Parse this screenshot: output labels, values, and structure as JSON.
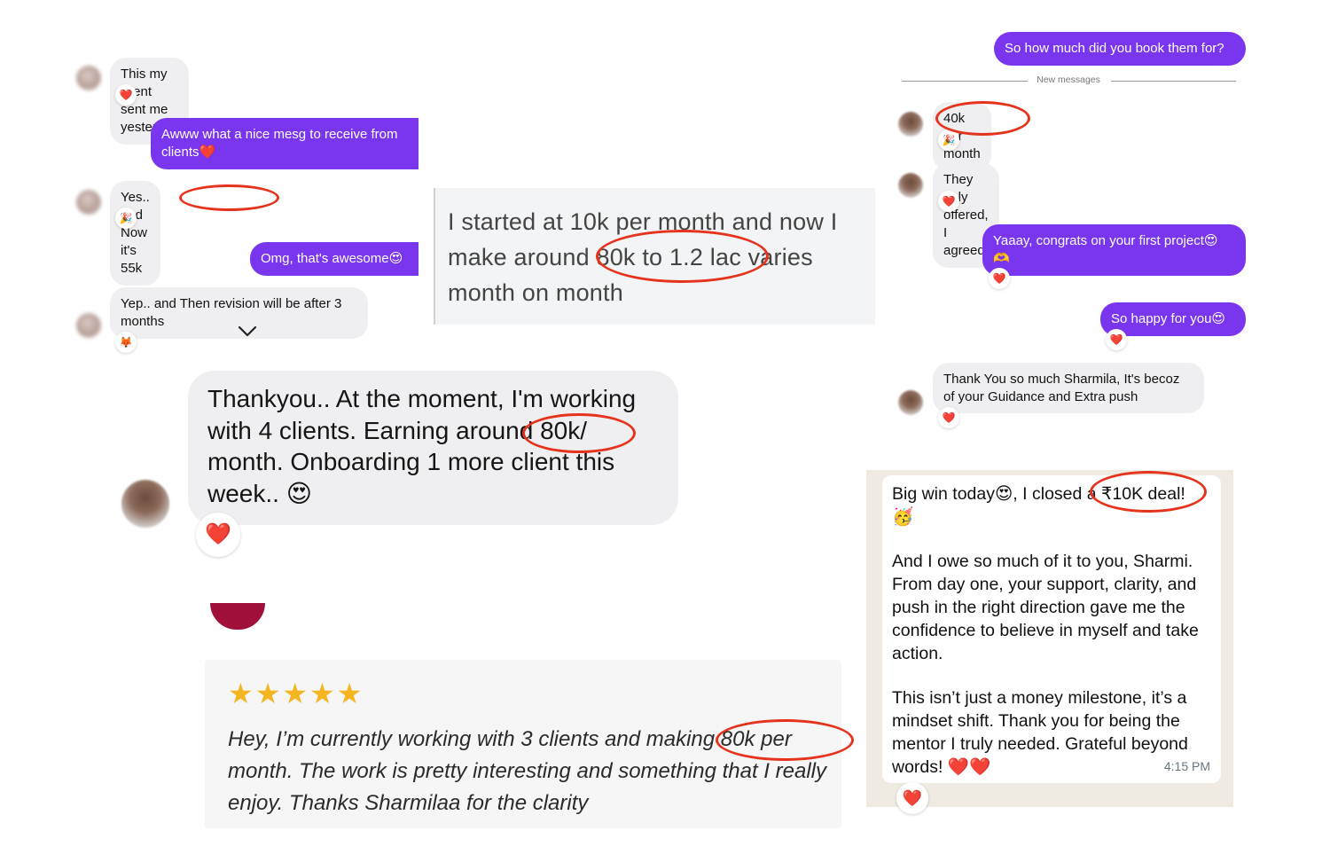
{
  "left_chat": {
    "msg1": "This my client sent me yesterday",
    "msg2": "Awww what a nice mesg to receive from clients❤️",
    "msg3": "Yes.. and Now it's 55k",
    "msg4": "Omg, that's awesome😍",
    "msg5": "Yep.. and Then revision will be after 3 months"
  },
  "center_card": {
    "text": "I started at 10k per month and now I make around 80k to 1.2 lac varies month on month"
  },
  "big_bubble": {
    "text": "Thankyou.. At the moment, I'm working with 4 clients. Earning around 80k/ month. Onboarding 1 more  client this week.. 😍"
  },
  "review": {
    "stars": "★★★★★",
    "text": "Hey, I’m currently working with 3 clients and making 80k per month. The work is pretty interesting and something that I really enjoy. Thanks Sharmilaa for the clarity"
  },
  "right_chat": {
    "q": "So how much did you book them for?",
    "divider": "New messages",
    "a1": "40k per month",
    "a2": "They only offered, I agreed",
    "out1": "Yaaay, congrats on your first project😍 🫶",
    "out2": "So happy for you😍",
    "a3": "Thank You so much Sharmila, It's becoz of your Guidance and Extra push"
  },
  "whatsapp": {
    "p1": "Big win today😍, I closed a ₹10K deal! 🥳",
    "p2": "And I owe so much of it to you, Sharmi. From day one, your support, clarity, and push in the right direction gave me the confidence to believe in myself and take action.",
    "p3": "This isn’t just a money milestone, it’s a mindset shift. Thank you for being the mentor I truly needed. Grateful beyond words! ❤️❤️",
    "time": "4:15 PM"
  },
  "reactions": {
    "heart": "❤️",
    "party": "🎉",
    "cool": "🦊"
  },
  "colors": {
    "outgoing_bubble": "#7a35ef",
    "incoming_bubble": "#efeff1",
    "highlight_oval": "#e5331d",
    "star": "#f5b521",
    "whatsapp_bg": "#efeae2"
  }
}
